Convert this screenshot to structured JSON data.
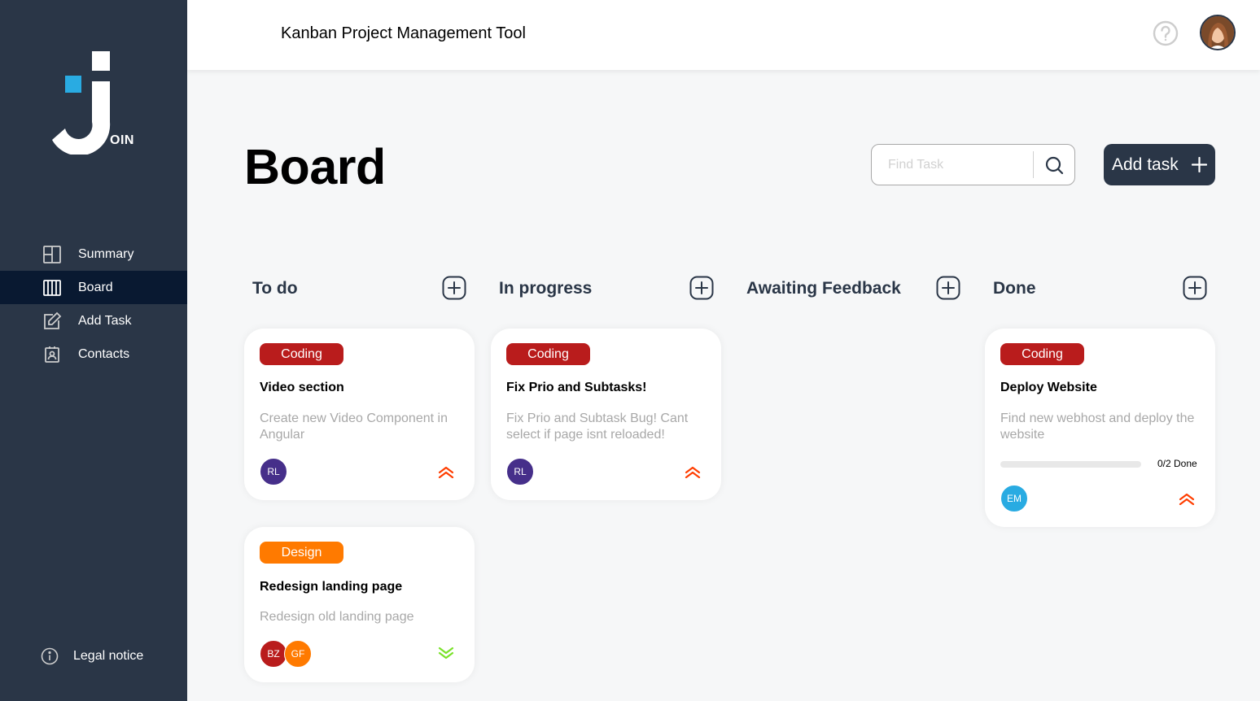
{
  "app": {
    "logo_text": "OIN"
  },
  "sidebar": {
    "items": [
      {
        "label": "Summary",
        "icon": "summary-icon",
        "active": false
      },
      {
        "label": "Board",
        "icon": "board-icon",
        "active": true
      },
      {
        "label": "Add Task",
        "icon": "add-task-icon",
        "active": false
      },
      {
        "label": "Contacts",
        "icon": "contacts-icon",
        "active": false
      }
    ],
    "legal": "Legal notice"
  },
  "header": {
    "title": "Kanban Project Management Tool",
    "help_icon": "question-icon",
    "user_avatar": "user-avatar"
  },
  "board": {
    "title": "Board",
    "search_placeholder": "Find Task",
    "add_task_label": "Add task"
  },
  "columns": [
    {
      "title": "To do"
    },
    {
      "title": "In progress"
    },
    {
      "title": "Awaiting Feedback"
    },
    {
      "title": "Done"
    }
  ],
  "cards": [
    {
      "column": "To do",
      "category": "Coding",
      "title": "Video section",
      "description": "Create new Video Component in Angular",
      "assignees": [
        {
          "initials": "RL",
          "color": "#462f8a"
        }
      ],
      "priority": "urgent"
    },
    {
      "column": "To do",
      "category": "Design",
      "title": "Redesign landing page",
      "description": "Redesign old landing page",
      "assignees": [
        {
          "initials": "BZ",
          "color": "#b91c1c"
        },
        {
          "initials": "GF",
          "color": "#ff7a00"
        }
      ],
      "priority": "low"
    },
    {
      "column": "In progress",
      "category": "Coding",
      "title": "Fix Prio and Subtasks!",
      "description": "Fix Prio and Subtask Bug! Cant select if page isnt reloaded!",
      "assignees": [
        {
          "initials": "RL",
          "color": "#462f8a"
        }
      ],
      "priority": "urgent"
    },
    {
      "column": "Done",
      "category": "Coding",
      "title": "Deploy Website",
      "description": "Find new webhost and deploy the website",
      "subtasks_text": "0/2 Done",
      "subtasks_done_fraction": 0,
      "assignees": [
        {
          "initials": "EM",
          "color": "#29abe2"
        }
      ],
      "priority": "urgent"
    }
  ],
  "colors": {
    "sidebar": "#2a3647",
    "active_nav": "#091931",
    "coding": "#b91c1c",
    "design": "#ff7a00",
    "urgent": "#ff3d00",
    "low": "#7ae229"
  }
}
